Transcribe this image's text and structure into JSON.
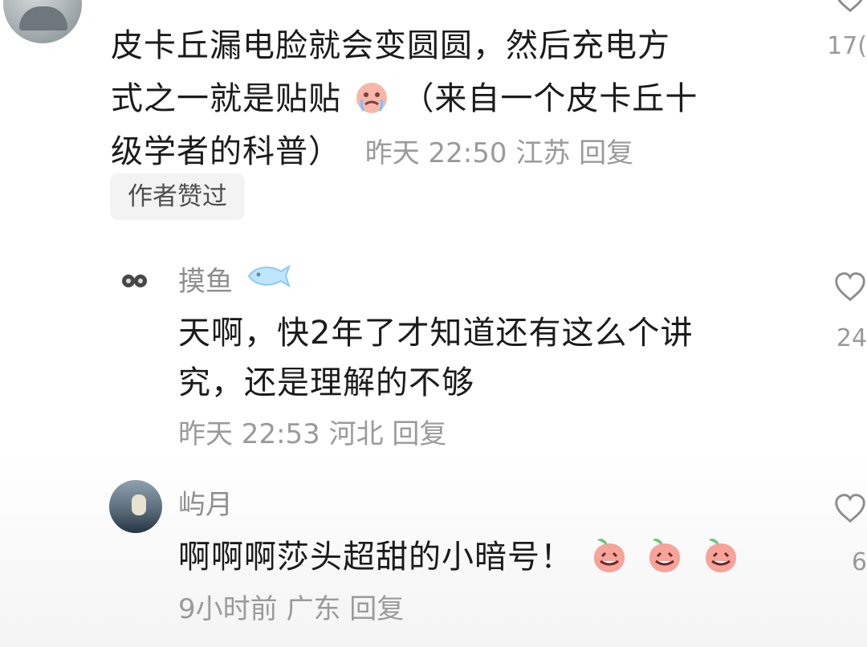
{
  "comment": {
    "text_line1": "皮卡丘漏电脸就会变圆圆，然后充电方",
    "text_line2_a": "式之一就是贴贴",
    "text_line2_b": "（来自一个皮卡丘十",
    "text_line3": "级学者的科普）",
    "meta": "昨天 22:50 江苏 回复",
    "author_badge": "作者赞过",
    "like_count_partial": "17(",
    "emoji": "crying-face-emoji"
  },
  "replies": [
    {
      "username": "摸鱼",
      "text_line1": "天啊，快2年了才知道还有这么个讲",
      "text_line2": "究，还是理解的不够",
      "meta": "昨天 22:53 河北 回复",
      "like_count_partial": "24",
      "icon": "fish-icon"
    },
    {
      "username": "屿月",
      "text": "啊啊啊莎头超甜的小暗号！",
      "meta": "9小时前 广东 回复",
      "like_count_partial": "6",
      "emoji": "peach-laughing-emoji"
    }
  ],
  "colors": {
    "text": "#1b1b1b",
    "secondary": "#9a9a9a",
    "badge_bg": "#f3f3f3"
  }
}
